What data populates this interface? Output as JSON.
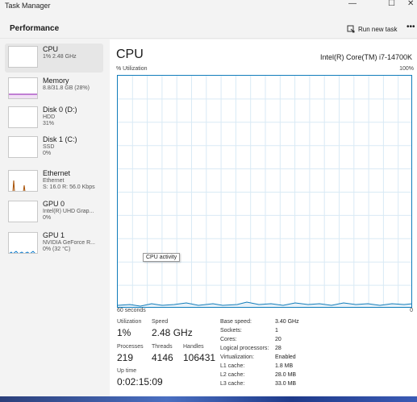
{
  "window": {
    "title": "Task Manager",
    "controls": {
      "minimize": "—",
      "maximize": "☐",
      "close": "✕"
    }
  },
  "header": {
    "page_title": "Performance",
    "run_new_task": "Run new task",
    "more": "•••"
  },
  "sidebar": {
    "items": [
      {
        "label": "CPU",
        "sub1": "1% 2.48 GHz",
        "sub2": "",
        "active": true
      },
      {
        "label": "Memory",
        "sub1": "8.8/31.8 GB (28%)",
        "sub2": ""
      },
      {
        "label": "Disk 0 (D:)",
        "sub1": "HDD",
        "sub2": "31%"
      },
      {
        "label": "Disk 1 (C:)",
        "sub1": "SSD",
        "sub2": "0%"
      },
      {
        "label": "Ethernet",
        "sub1": "Ethernet",
        "sub2": "S: 16.0 R: 56.0 Kbps"
      },
      {
        "label": "GPU 0",
        "sub1": "Intel(R) UHD Grap...",
        "sub2": "0%"
      },
      {
        "label": "GPU 1",
        "sub1": "NVIDIA GeForce R...",
        "sub2": "0% (32 °C)"
      }
    ]
  },
  "main": {
    "title": "CPU",
    "model": "Intel(R) Core(TM) i7-14700K",
    "util_label": "% Utilization",
    "util_max": "100%",
    "tooltip": "CPU activity",
    "time_left": "60 seconds",
    "time_right": "0",
    "stats": {
      "utilization_label": "Utilization",
      "utilization": "1%",
      "speed_label": "Speed",
      "speed": "2.48 GHz",
      "processes_label": "Processes",
      "processes": "219",
      "threads_label": "Threads",
      "threads": "4146",
      "handles_label": "Handles",
      "handles": "106431",
      "uptime_label": "Up time",
      "uptime": "0:02:15:09"
    },
    "info": [
      {
        "label": "Base speed:",
        "value": "3.40 GHz"
      },
      {
        "label": "Sockets:",
        "value": "1"
      },
      {
        "label": "Cores:",
        "value": "20"
      },
      {
        "label": "Logical processors:",
        "value": "28"
      },
      {
        "label": "Virtualization:",
        "value": "Enabled"
      },
      {
        "label": "L1 cache:",
        "value": "1.8 MB"
      },
      {
        "label": "L2 cache:",
        "value": "28.0 MB"
      },
      {
        "label": "L3 cache:",
        "value": "33.0 MB"
      }
    ]
  },
  "colors": {
    "cpu": "#117dbb",
    "memory": "#8b12ae",
    "disk": "#4da60c",
    "ethernet": "#a74f01",
    "gpu": "#0b7acb"
  }
}
